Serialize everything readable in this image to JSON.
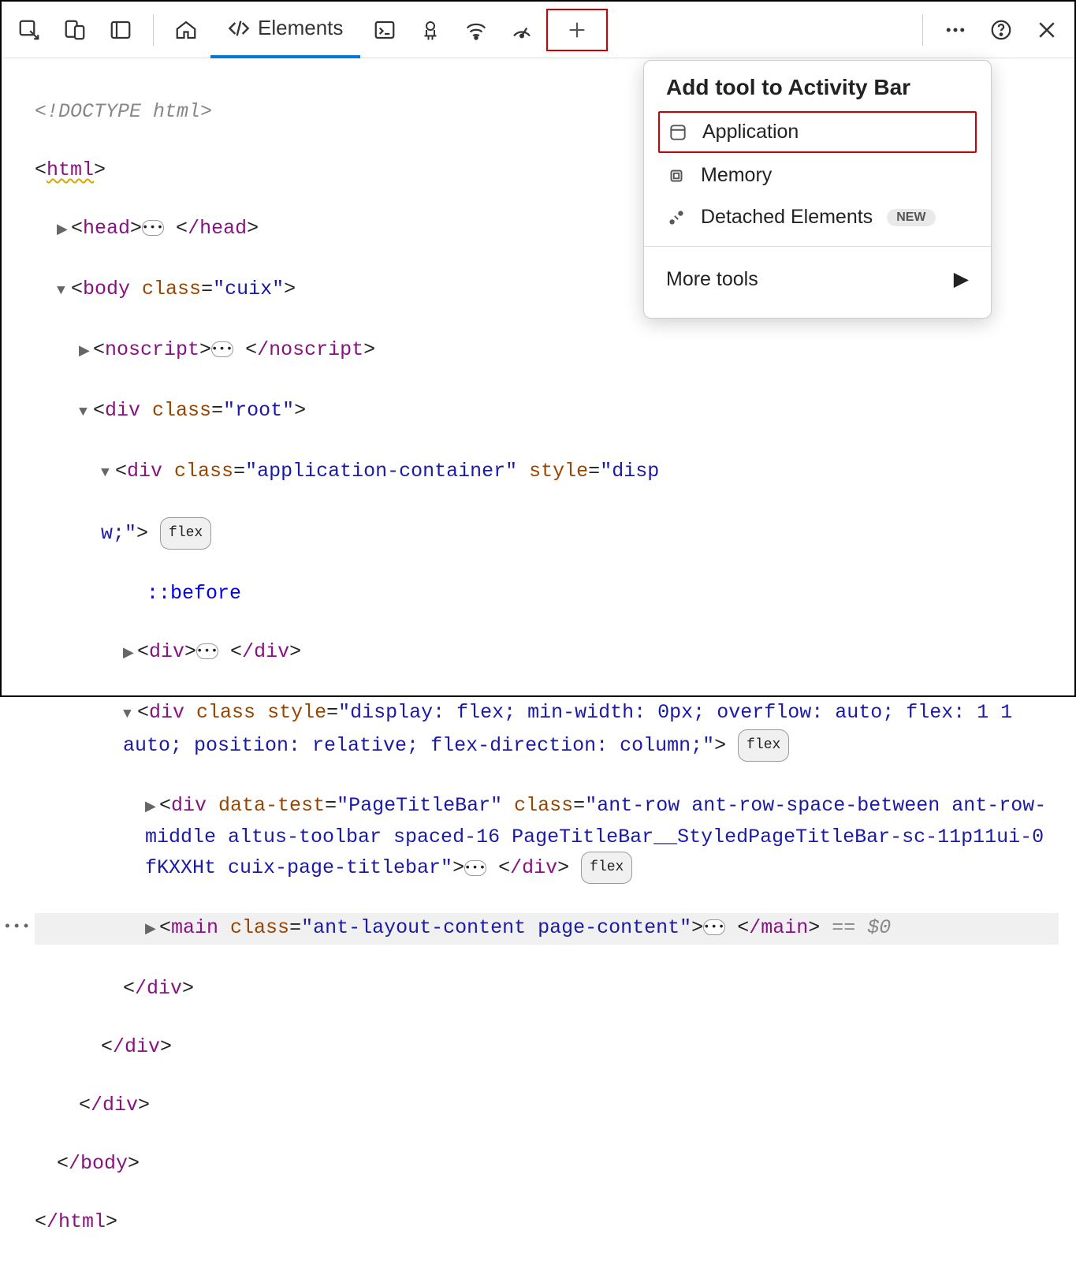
{
  "toolbar": {
    "elements_tab_label": "Elements"
  },
  "popup": {
    "title": "Add tool to Activity Bar",
    "items": {
      "application": "Application",
      "memory": "Memory",
      "detached_elements": "Detached Elements",
      "new_badge": "NEW"
    },
    "more_tools": "More tools"
  },
  "dom": {
    "doctype": "<!DOCTYPE html>",
    "html_open": "html",
    "head_open": "head",
    "head_close": "/head",
    "body_open_tag": "body",
    "body_attr_class": "class",
    "body_class_val": "\"cuix\"",
    "noscript_open": "noscript",
    "noscript_close": "/noscript",
    "div_root_tag": "div",
    "div_root_class_val": "\"root\"",
    "div_app_class_val": "\"application-container\"",
    "div_app_style_attr": "style",
    "div_app_style_val_part1": "\"disp",
    "div_app_style_val_part2": "w;\"",
    "before_pseudo": "::before",
    "div_close": "/div",
    "div_flex_style_val": "\"display: flex; min-width: 0px; overflow: auto; flex: 1 1 auto; position: relative; flex-direction: column;\"",
    "div_pagetitle_datatest": "data-test",
    "div_pagetitle_datatest_val": "\"PageTitleBar\"",
    "div_pagetitle_class_val": "\"ant-row ant-row-space-between ant-row-middle altus-toolbar spaced-16 PageTitleBar__StyledPageTitleBar-sc-11p11ui-0 fKXXHt cuix-page-titlebar\"",
    "main_tag": "main",
    "main_class_val": "\"ant-layout-content page-content\"",
    "main_close": "/main",
    "body_close": "/body",
    "html_close": "/html",
    "eq_dollar": " == $0",
    "flex_badge": "flex",
    "dots": "•••"
  }
}
